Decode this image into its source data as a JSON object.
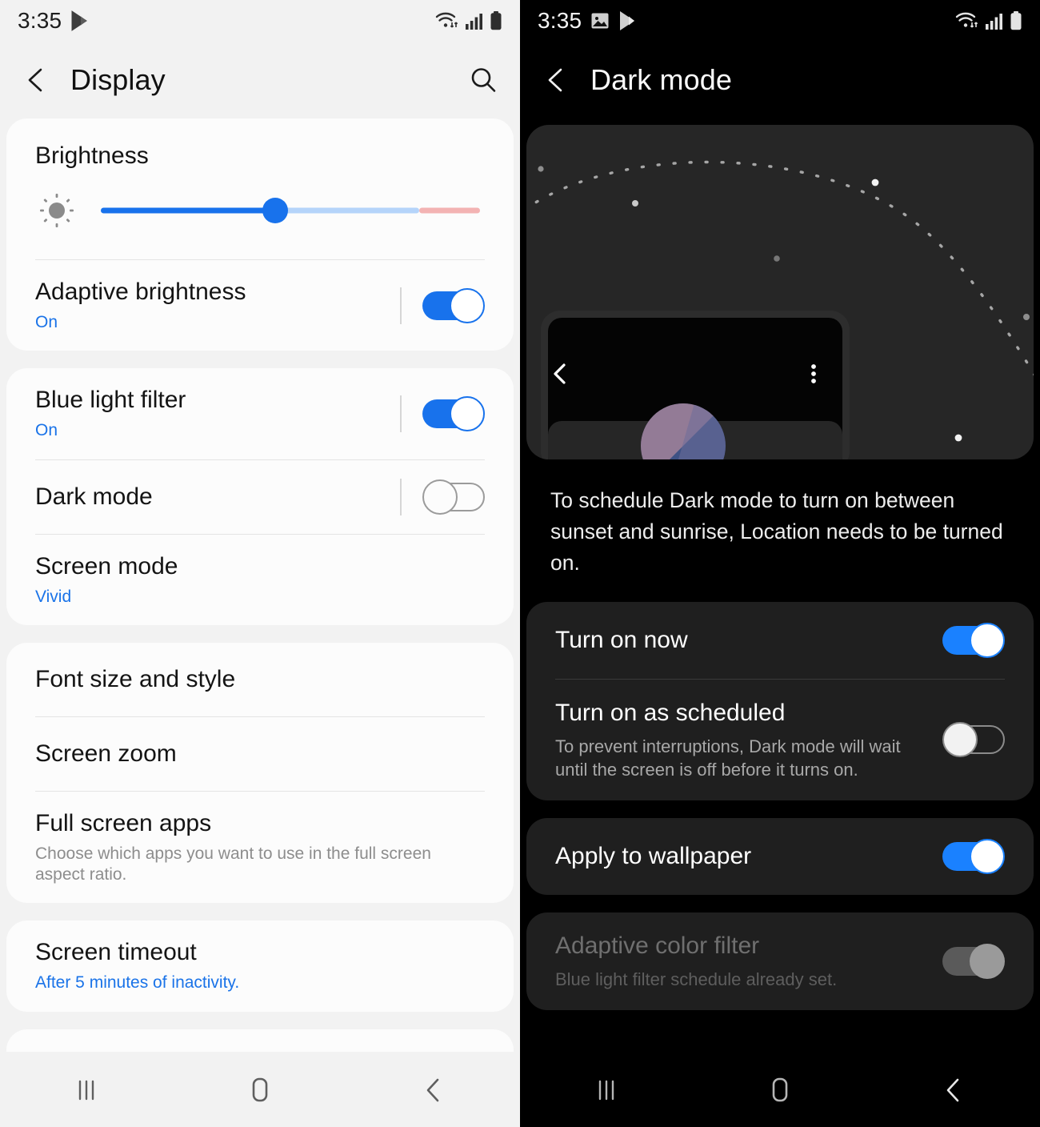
{
  "left": {
    "status": {
      "time": "3:35",
      "icons": [
        "play-store-icon",
        "wifi-icon",
        "signal-icon",
        "battery-icon"
      ]
    },
    "header": {
      "title": "Display",
      "back_icon": "back-chevron-icon",
      "search_icon": "search-icon"
    },
    "brightness": {
      "label": "Brightness",
      "slider_icon": "sun-icon",
      "value_percent": 46,
      "warm_start_percent": 84,
      "track_color": "#1872EC",
      "mid_color": "#B5D4FA",
      "warm_color": "#F3B3B3"
    },
    "rows": {
      "adaptive_brightness": {
        "title": "Adaptive brightness",
        "sub": "On",
        "state": "on"
      },
      "blue_light_filter": {
        "title": "Blue light filter",
        "sub": "On",
        "state": "on"
      },
      "dark_mode": {
        "title": "Dark mode",
        "state": "off"
      },
      "screen_mode": {
        "title": "Screen mode",
        "sub": "Vivid"
      },
      "font_size": {
        "title": "Font size and style"
      },
      "screen_zoom": {
        "title": "Screen zoom"
      },
      "full_screen_apps": {
        "title": "Full screen apps",
        "sub": "Choose which apps you want to use in the full screen aspect ratio."
      },
      "screen_timeout": {
        "title": "Screen timeout",
        "sub": "After 5 minutes of inactivity."
      }
    },
    "nav": {
      "recents": "recents-icon",
      "home": "home-icon",
      "back": "back-icon"
    }
  },
  "right": {
    "status": {
      "time": "3:35",
      "icons": [
        "gallery-icon",
        "play-store-icon",
        "wifi-icon",
        "signal-icon",
        "battery-icon"
      ]
    },
    "header": {
      "title": "Dark mode",
      "back_icon": "back-chevron-icon"
    },
    "hero": {
      "illustration": "dark-mode-illustration",
      "moon_color": "#FCC81E",
      "phone_back_icon": "back-chevron-icon",
      "phone_menu_icon": "overflow-menu-icon"
    },
    "description": "To schedule Dark mode to turn on between sunset and sunrise, Location needs to be turned on.",
    "rows": {
      "turn_on_now": {
        "title": "Turn on now",
        "state": "on"
      },
      "turn_on_scheduled": {
        "title": "Turn on as scheduled",
        "sub": "To prevent interruptions, Dark mode will wait until the screen is off before it turns on.",
        "state": "off"
      },
      "apply_wallpaper": {
        "title": "Apply to wallpaper",
        "state": "on"
      },
      "adaptive_color_filter": {
        "title": "Adaptive color filter",
        "sub": "Blue light filter schedule already set.",
        "state": "disabled"
      }
    },
    "nav": {
      "recents": "recents-icon",
      "home": "home-icon",
      "back": "back-icon"
    }
  },
  "colors": {
    "accent_blue": "#1872EC",
    "dark_accent_blue": "#1A81FF",
    "moon_yellow": "#FCC81E"
  }
}
